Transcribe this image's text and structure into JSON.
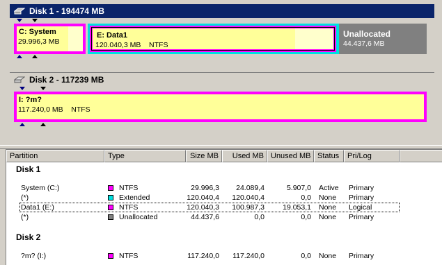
{
  "disk1": {
    "title": "Disk 1 - 194474 MB",
    "partitions": {
      "c": {
        "name": "C:  System",
        "size": "29.996,3 MB"
      },
      "e": {
        "name": "E:  Data1",
        "detail": "120.040,3 MB    NTFS"
      },
      "unallocated": {
        "name": "Unallocated",
        "size": "44.437,6 MB"
      }
    }
  },
  "disk2": {
    "title": "Disk 2 - 117239 MB",
    "partitions": {
      "i": {
        "name": "I:  ?m?",
        "detail": "117.240,0 MB    NTFS"
      }
    }
  },
  "columns": [
    "Partition",
    "Type",
    "Size MB",
    "Used MB",
    "Unused MB",
    "Status",
    "Pri/Log"
  ],
  "groups": {
    "disk1": "Disk 1",
    "disk2": "Disk 2"
  },
  "rows": {
    "r1": {
      "partition": "System (C:)",
      "type": "NTFS",
      "size": "29.996,3",
      "used": "24.089,4",
      "unused": "5.907,0",
      "status": "Active",
      "prilog": "Primary"
    },
    "r2": {
      "partition": "(*)",
      "type": "Extended",
      "size": "120.040,4",
      "used": "120.040,4",
      "unused": "0,0",
      "status": "None",
      "prilog": "Primary"
    },
    "r3": {
      "partition": "Data1 (E:)",
      "type": "NTFS",
      "size": "120.040,3",
      "used": "100.987,3",
      "unused": "19.053,1",
      "status": "None",
      "prilog": "Logical"
    },
    "r4": {
      "partition": "(*)",
      "type": "Unallocated",
      "size": "44.437,6",
      "used": "0,0",
      "unused": "0,0",
      "status": "None",
      "prilog": "Primary"
    },
    "r5": {
      "partition": "?m? (I:)",
      "type": "NTFS",
      "size": "117.240,0",
      "used": "117.240,0",
      "unused": "0,0",
      "status": "None",
      "prilog": "Primary"
    }
  },
  "colors": {
    "ntfs": "#ff00ff",
    "extended": "#00e0e0",
    "unallocated": "#808080",
    "selection": "#0a246a"
  },
  "icons": {
    "disk": "hard-disk-icon",
    "marker": "triangle-marker-icon"
  }
}
